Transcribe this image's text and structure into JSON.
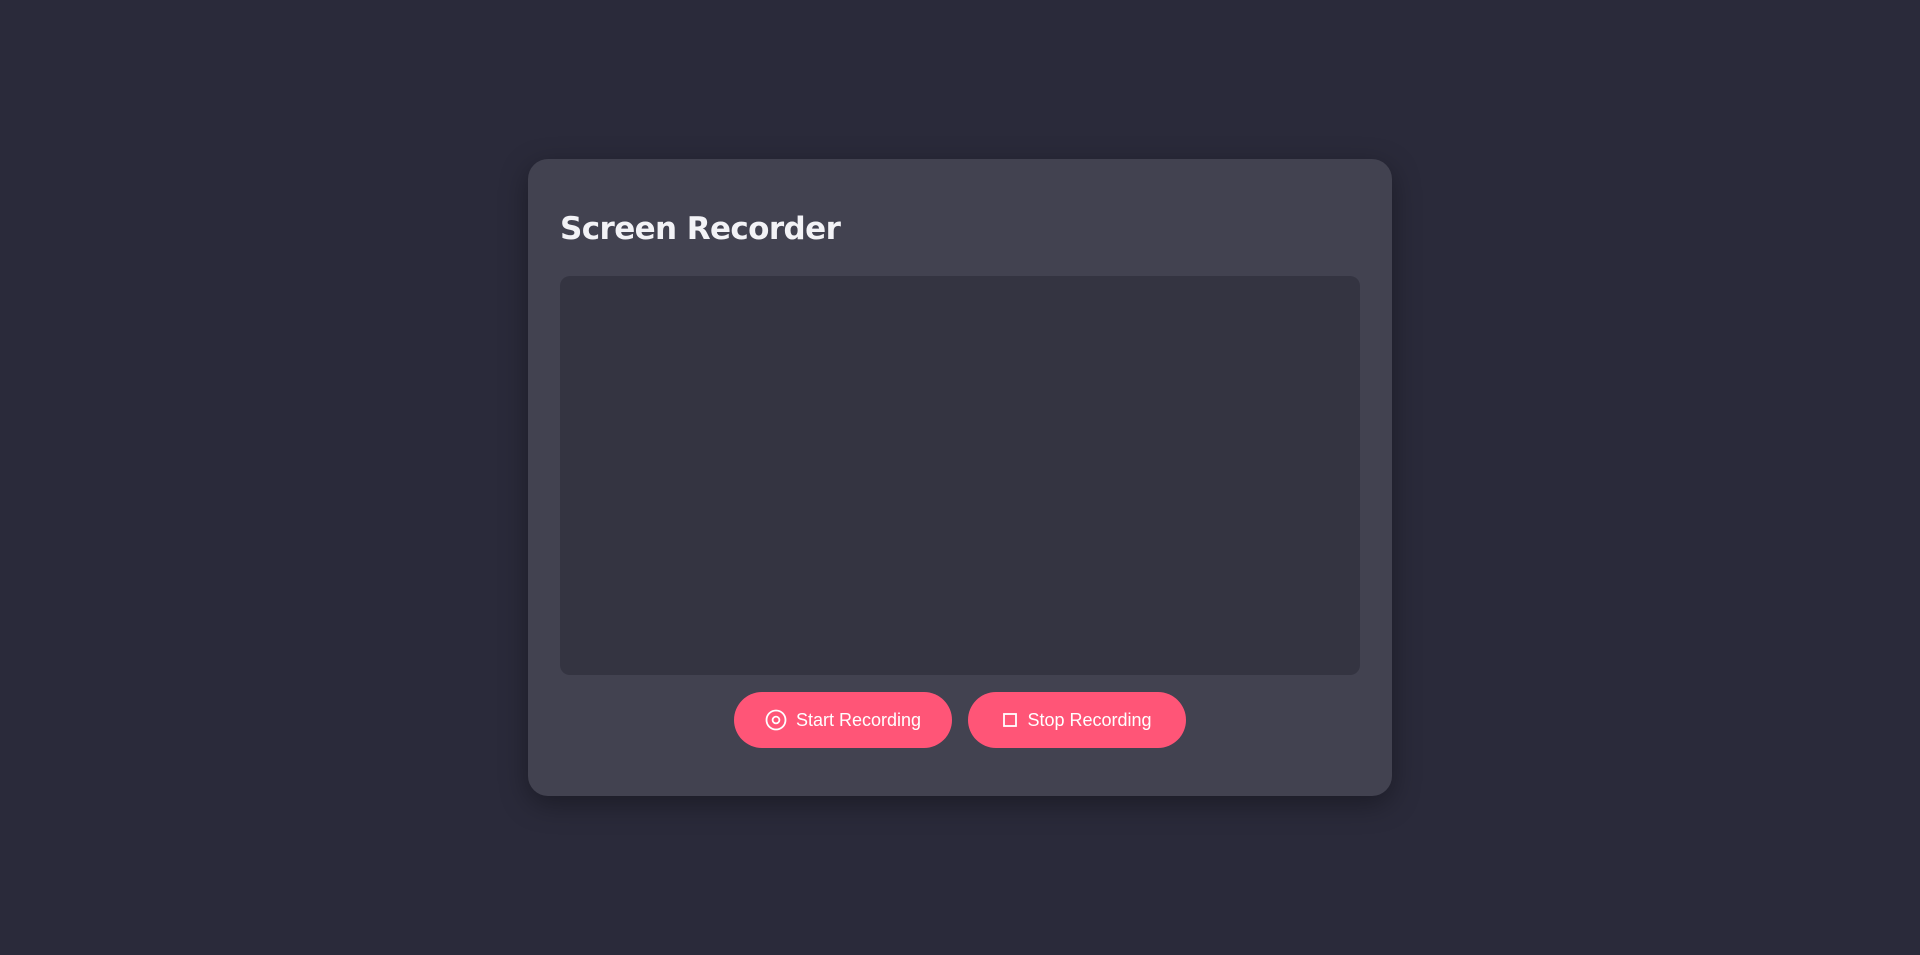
{
  "app": {
    "title": "Screen Recorder"
  },
  "controls": {
    "start": {
      "label": "Start Recording",
      "icon": "record-icon"
    },
    "stop": {
      "label": "Stop Recording",
      "icon": "stop-icon"
    }
  },
  "colors": {
    "background": "#2a2a3a",
    "card": "#424250",
    "preview": "#343441",
    "accent": "#ff5577",
    "title_text": "#f2f2f6"
  }
}
